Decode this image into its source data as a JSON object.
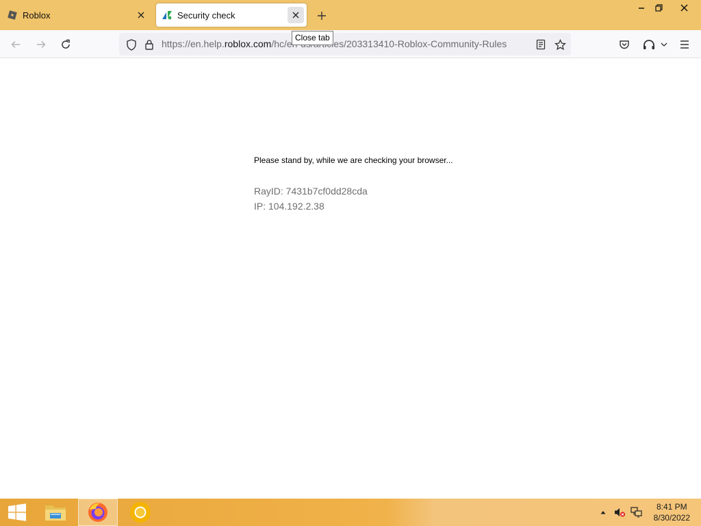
{
  "browser": {
    "tabs": [
      {
        "title": "Roblox",
        "active": false,
        "favicon": "roblox-logo-icon"
      },
      {
        "title": "Security check",
        "active": true,
        "favicon": "zendesk-logo-icon"
      }
    ],
    "tooltip": "Close tab",
    "url": {
      "prefix": "https://en.help.",
      "host": "roblox.com",
      "path": "/hc/en-us/articles/203313410-Roblox-Community-Rules"
    },
    "icons": {
      "back": "arrow-left-icon",
      "forward": "arrow-right-icon",
      "reload": "reload-icon",
      "tracking_protection": "shield-icon",
      "lock": "lock-icon",
      "reader": "reader-view-icon",
      "bookmark": "star-icon",
      "pocket": "pocket-icon",
      "extension": "extension-icon",
      "menu": "hamburger-menu-icon"
    }
  },
  "page": {
    "message": "Please stand by, while we are checking your browser...",
    "ray_id": "RayID: 7431b7cf0dd28cda",
    "ip": "IP: 104.192.2.38"
  },
  "taskbar": {
    "time": "8:41 PM",
    "date": "8/30/2022",
    "apps": [
      "start-button",
      "file-explorer-icon",
      "firefox-icon",
      "chrome-icon"
    ]
  },
  "colors": {
    "tabstrip": "#f0c46a",
    "taskbar": "#e8a63a",
    "accent": "#15141a"
  }
}
